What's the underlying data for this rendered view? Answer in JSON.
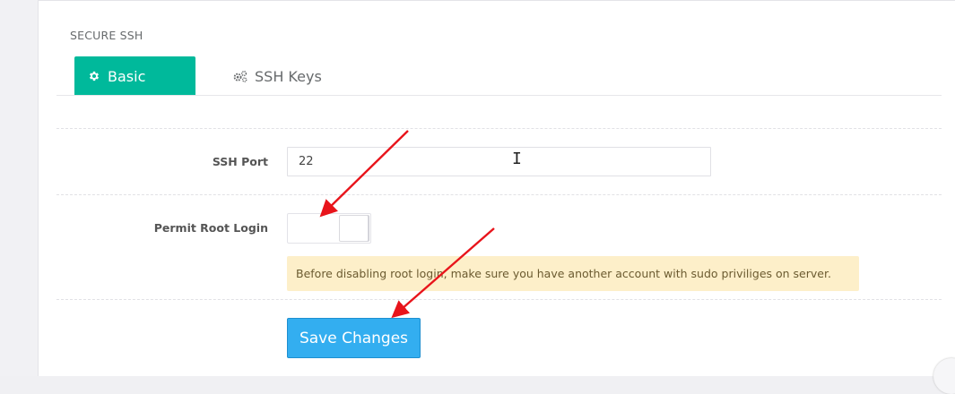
{
  "panel": {
    "title": "SECURE SSH"
  },
  "tabs": [
    {
      "label": "Basic",
      "icon": "gear-icon",
      "active": true
    },
    {
      "label": "SSH Keys",
      "icon": "gears-icon",
      "active": false
    }
  ],
  "form": {
    "ssh_port": {
      "label": "SSH Port",
      "value": "22"
    },
    "permit_root_login": {
      "label": "Permit Root Login",
      "enabled": false
    },
    "warning": "Before disabling root login, make sure you have another account with sudo priviliges on server."
  },
  "actions": {
    "save_label": "Save Changes"
  },
  "colors": {
    "tab_active": "#00b99b",
    "save_button": "#33aef0",
    "alert_background": "#fdefc9",
    "annotation_arrow": "#e8141b"
  }
}
